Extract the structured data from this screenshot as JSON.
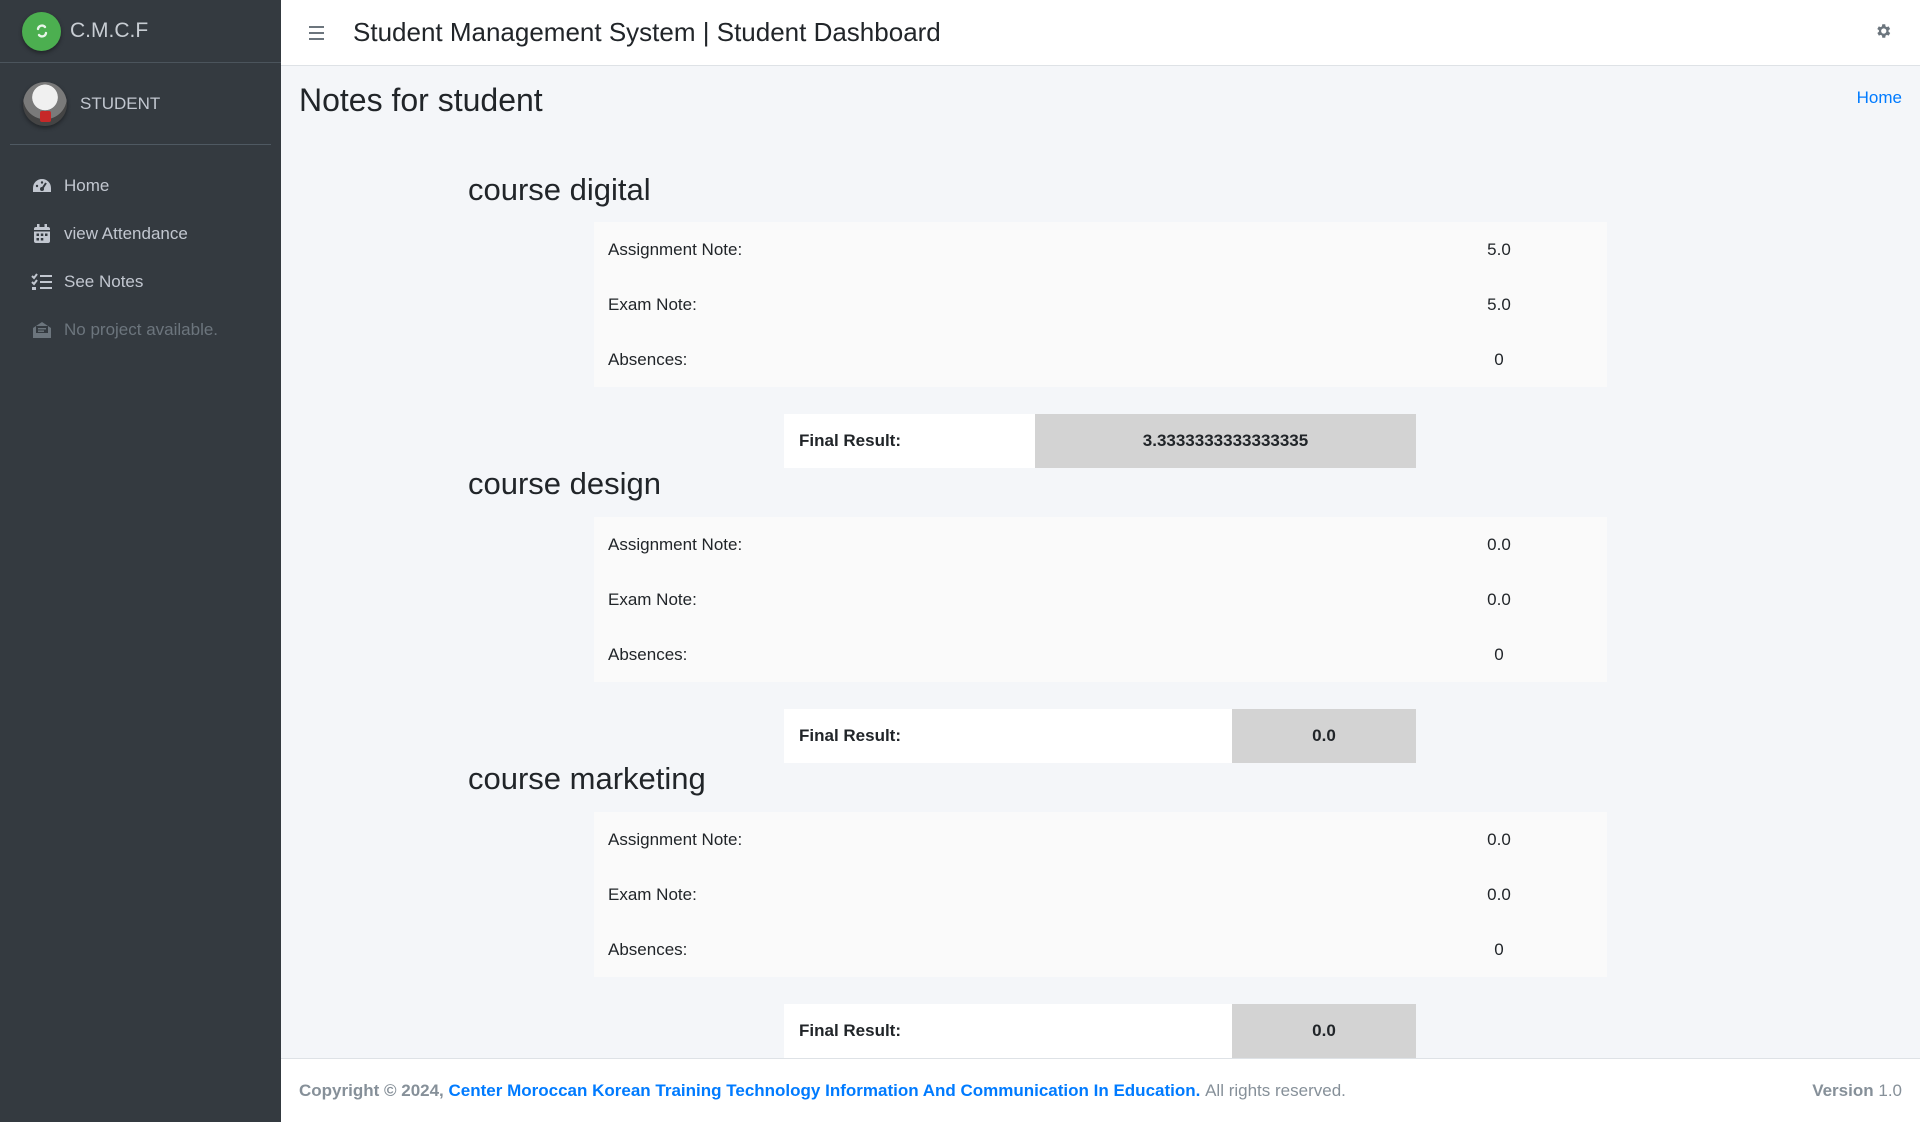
{
  "brand": {
    "name": "C.M.C.F"
  },
  "user": {
    "name": "STUDENT"
  },
  "sidebar": {
    "items": [
      {
        "label": "Home",
        "icon": "dashboard-icon"
      },
      {
        "label": "view Attendance",
        "icon": "calendar-icon"
      },
      {
        "label": "See Notes",
        "icon": "tasks-icon"
      },
      {
        "label": "No project available.",
        "icon": "envelope-open-icon"
      }
    ]
  },
  "navbar": {
    "title": "Student Management System | Student Dashboard"
  },
  "header": {
    "title": "Notes for student",
    "breadcrumb": "Home"
  },
  "courses": [
    {
      "title": "course digital",
      "assignment_label": "Assignment Note:",
      "assignment": "5.0",
      "exam_label": "Exam Note:",
      "exam": "5.0",
      "absences_label": "Absences:",
      "absences": "0",
      "final_label": "Final Result:",
      "final": "3.3333333333333335"
    },
    {
      "title": "course design",
      "assignment_label": "Assignment Note:",
      "assignment": "0.0",
      "exam_label": "Exam Note:",
      "exam": "0.0",
      "absences_label": "Absences:",
      "absences": "0",
      "final_label": "Final Result:",
      "final": "0.0"
    },
    {
      "title": "course marketing",
      "assignment_label": "Assignment Note:",
      "assignment": "0.0",
      "exam_label": "Exam Note:",
      "exam": "0.0",
      "absences_label": "Absences:",
      "absences": "0",
      "final_label": "Final Result:",
      "final": "0.0"
    }
  ],
  "footer": {
    "copyright": "Copyright © 2024,",
    "org": "Center Moroccan Korean Training Technology Information And Communication In Education.",
    "rights": "All rights reserved.",
    "version_label": "Version",
    "version": "1.0"
  },
  "colors": {
    "sidebar_bg": "#343a40",
    "link": "#007bff",
    "final_value_bg": "#d3d3d3",
    "brand_logo": "#4caf50"
  }
}
